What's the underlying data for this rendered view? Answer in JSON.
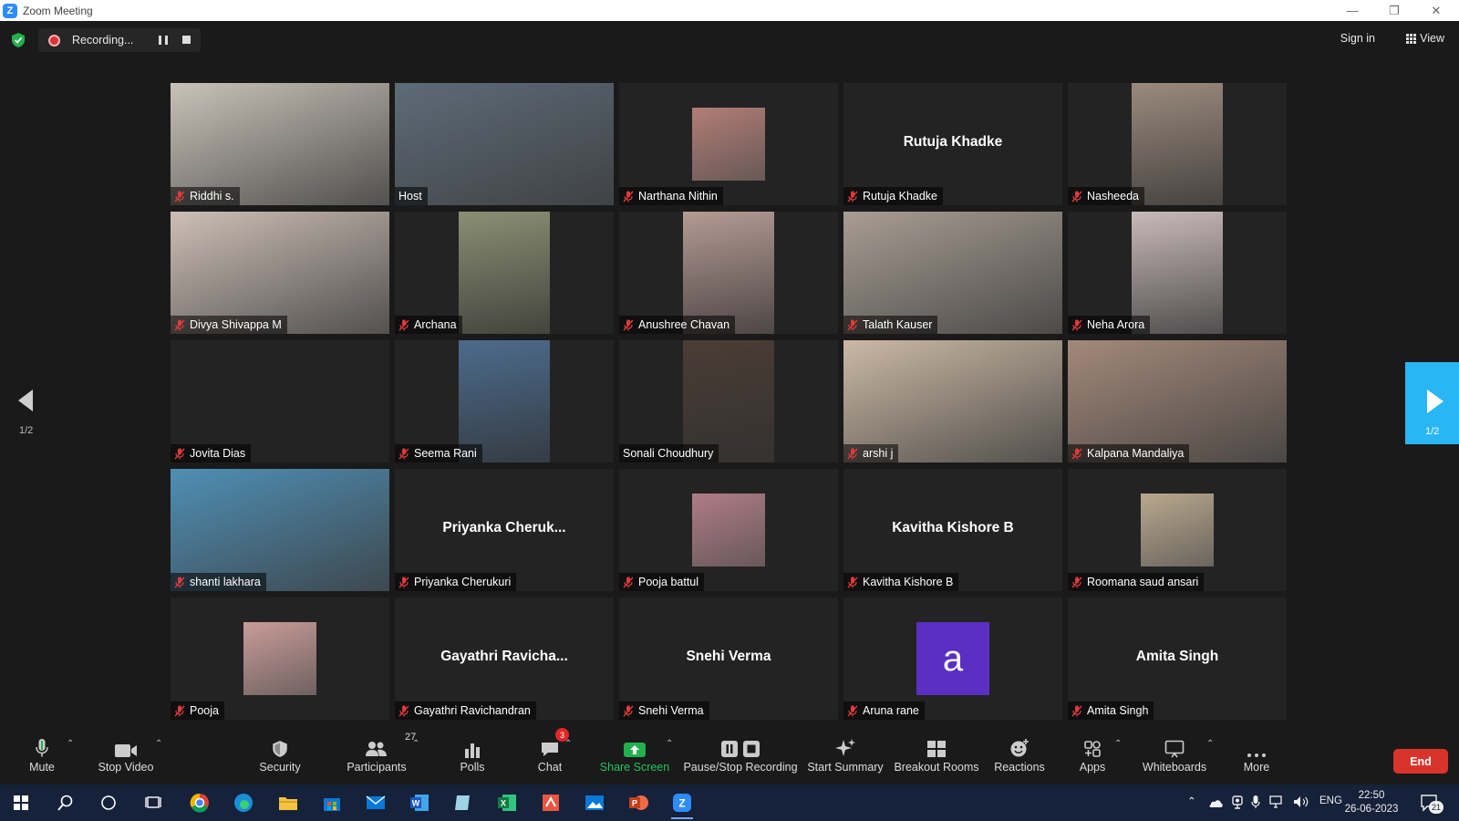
{
  "window": {
    "title": "Zoom Meeting"
  },
  "topbar": {
    "recording_label": "Recording...",
    "sign_in": "Sign in",
    "view": "View"
  },
  "participants": [
    {
      "name": "Riddhi s.",
      "big": "",
      "kind": "video",
      "color": "#c9c2b8",
      "active": false,
      "muted": true
    },
    {
      "name": "Host",
      "big": "",
      "kind": "video",
      "color": "#5d6b78",
      "active": true,
      "muted": false
    },
    {
      "name": "Narthana Nithin",
      "big": "",
      "kind": "avatar",
      "color": "#b27d76",
      "active": false,
      "muted": true
    },
    {
      "name": "Rutuja Khadke",
      "big": "Rutuja Khadke",
      "kind": "name",
      "color": "",
      "active": false,
      "muted": true
    },
    {
      "name": "Nasheeda",
      "big": "",
      "kind": "pic",
      "color": "#9a8a7d",
      "active": false,
      "muted": true
    },
    {
      "name": "Divya Shivappa M",
      "big": "",
      "kind": "video",
      "color": "#cdbfb6",
      "active": false,
      "muted": true
    },
    {
      "name": "Archana",
      "big": "",
      "kind": "pic",
      "color": "#8a8f73",
      "active": false,
      "muted": true
    },
    {
      "name": "Anushree Chavan",
      "big": "",
      "kind": "pic",
      "color": "#b49a93",
      "active": false,
      "muted": true
    },
    {
      "name": "Talath Kauser",
      "big": "",
      "kind": "video",
      "color": "#a89d93",
      "active": false,
      "muted": true
    },
    {
      "name": "Neha Arora",
      "big": "",
      "kind": "pic",
      "color": "#c8b9ba",
      "active": false,
      "muted": true
    },
    {
      "name": "Jovita Dias",
      "big": "",
      "kind": "blank",
      "color": "",
      "active": false,
      "muted": true
    },
    {
      "name": "Seema Rani",
      "big": "",
      "kind": "pic",
      "color": "#4c6b8c",
      "active": false,
      "muted": true
    },
    {
      "name": "Sonali Choudhury",
      "big": "",
      "kind": "pic",
      "color": "#4a3d35",
      "active": false,
      "muted": false
    },
    {
      "name": "arshi j",
      "big": "",
      "kind": "video",
      "color": "#cbb9a5",
      "active": false,
      "muted": true
    },
    {
      "name": "Kalpana Mandaliya",
      "big": "",
      "kind": "video",
      "color": "#a3897a",
      "active": false,
      "muted": true
    },
    {
      "name": "shanti lakhara",
      "big": "",
      "kind": "video",
      "color": "#4f8fb5",
      "active": false,
      "muted": true
    },
    {
      "name": "Priyanka Cherukuri",
      "big": "Priyanka  Cheruk...",
      "kind": "name",
      "color": "",
      "active": false,
      "muted": true
    },
    {
      "name": "Pooja battul",
      "big": "",
      "kind": "avatar",
      "color": "#b07c86",
      "active": false,
      "muted": true
    },
    {
      "name": "Kavitha Kishore B",
      "big": "Kavitha Kishore B",
      "kind": "name",
      "color": "",
      "active": false,
      "muted": true
    },
    {
      "name": "Roomana saud ansari",
      "big": "",
      "kind": "avatar",
      "color": "#b9a88e",
      "active": false,
      "muted": true
    },
    {
      "name": "Pooja",
      "big": "",
      "kind": "avatar",
      "color": "#c99c98",
      "active": false,
      "muted": true
    },
    {
      "name": "Gayathri Ravichandran",
      "big": "Gayathri  Ravicha...",
      "kind": "name",
      "color": "",
      "active": false,
      "muted": true
    },
    {
      "name": "Snehi Verma",
      "big": "Snehi Verma",
      "kind": "name",
      "color": "",
      "active": false,
      "muted": true
    },
    {
      "name": "Aruna rane",
      "big": "a",
      "kind": "letter",
      "color": "#5a2fc2",
      "active": false,
      "muted": true
    },
    {
      "name": "Amita Singh",
      "big": "Amita Singh",
      "kind": "name",
      "color": "",
      "active": false,
      "muted": true
    }
  ],
  "paging": {
    "prev_label": "1/2",
    "next_label": "1/2"
  },
  "toolbar": {
    "mute": "Mute",
    "stop_video": "Stop Video",
    "security": "Security",
    "participants": "Participants",
    "participants_count": "27",
    "polls": "Polls",
    "chat": "Chat",
    "chat_badge": "3",
    "share_screen": "Share Screen",
    "pause_stop_recording": "Pause/Stop Recording",
    "start_summary": "Start Summary",
    "breakout_rooms": "Breakout Rooms",
    "reactions": "Reactions",
    "apps": "Apps",
    "whiteboards": "Whiteboards",
    "more": "More",
    "end": "End"
  },
  "taskbar": {
    "lang": "ENG",
    "time": "22:50",
    "date": "26-06-2023",
    "notifications": "21"
  }
}
